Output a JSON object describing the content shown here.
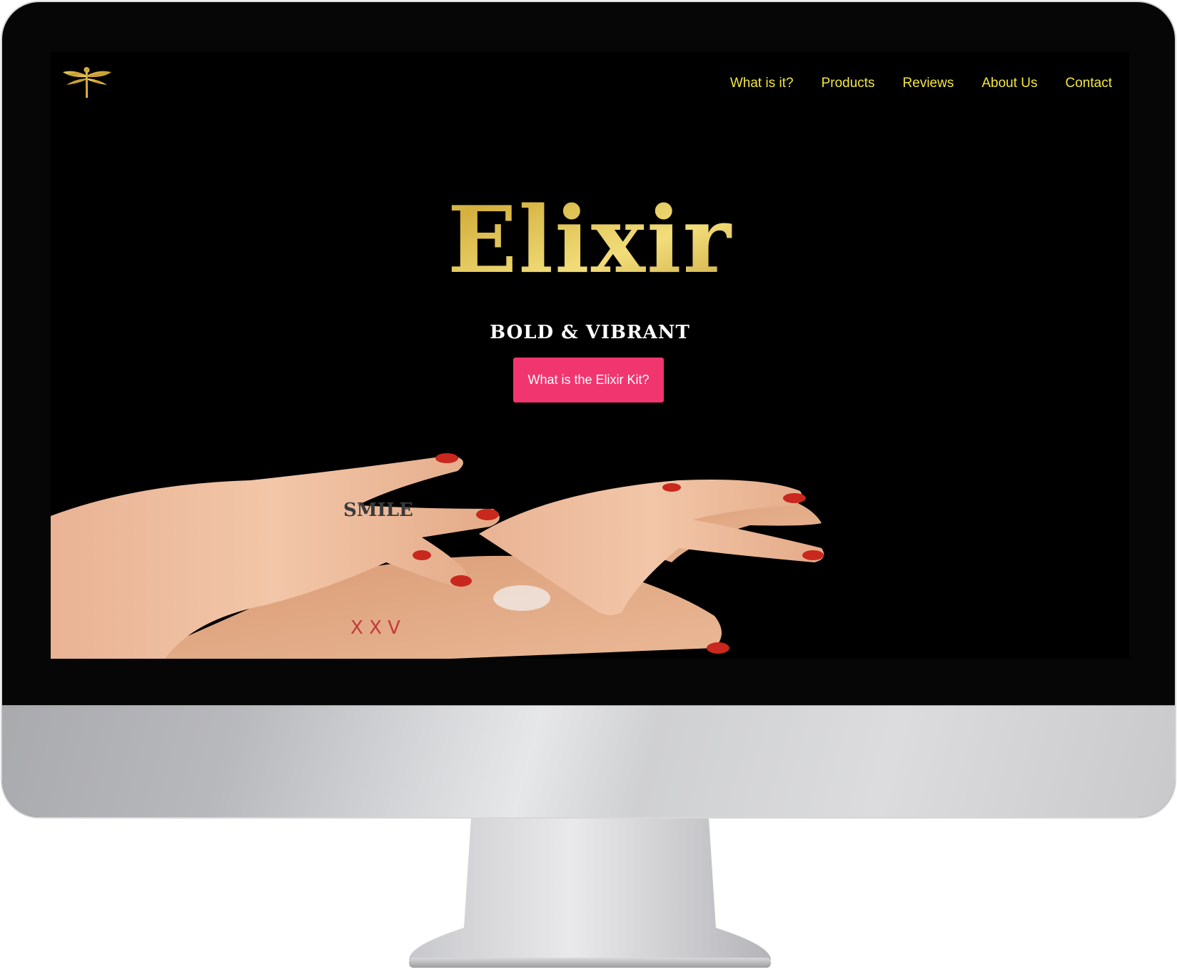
{
  "site": {
    "logo_icon": "dragonfly-icon",
    "nav": [
      {
        "label": "What is it?"
      },
      {
        "label": "Products"
      },
      {
        "label": "Reviews"
      },
      {
        "label": "About Us"
      },
      {
        "label": "Contact"
      }
    ],
    "hero": {
      "brand": "Elixir",
      "tagline": "BOLD & VIBRANT",
      "cta_label": "What is the Elixir Kit?"
    },
    "hand_tattoos": {
      "finger": "SMILE",
      "hand": "X X V"
    }
  },
  "colors": {
    "nav_text": "#f3e73f",
    "cta_bg": "#f0356f",
    "gold": "#d4b13f",
    "background": "#000000"
  }
}
